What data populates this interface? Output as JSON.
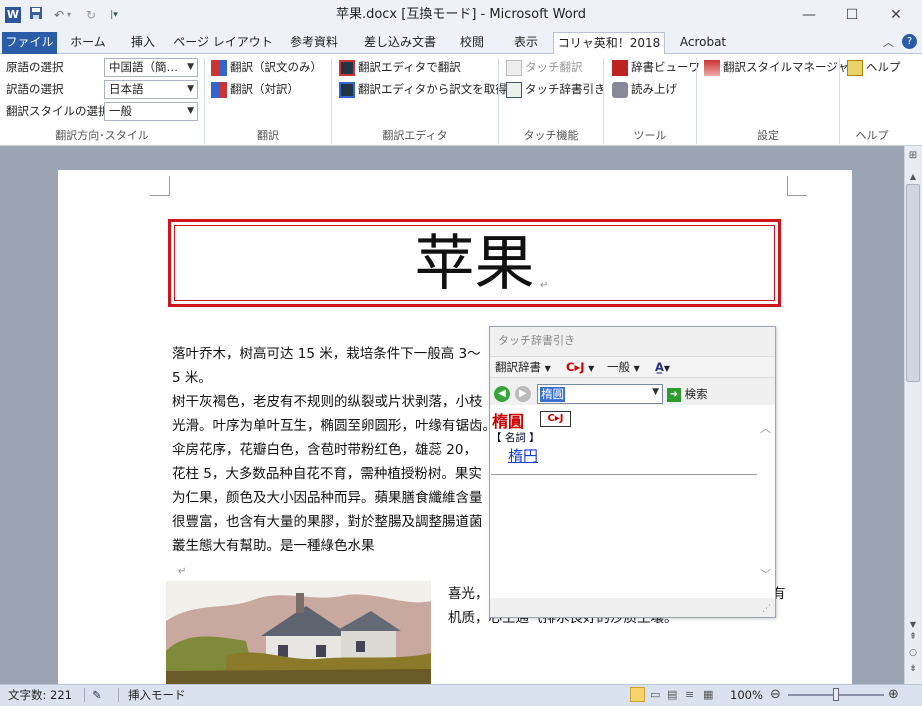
{
  "window": {
    "title": "苹果.docx [互換モード] - Microsoft Word",
    "app_icon": "word-icon",
    "qat": [
      "save-icon",
      "undo-icon",
      "redo-icon",
      "customize-icon"
    ],
    "controls": [
      "minimize-icon",
      "maximize-icon",
      "close-icon"
    ]
  },
  "tabs": {
    "file": "ファイル",
    "home": "ホーム",
    "insert": "挿入",
    "layout": "ページ レイアウト",
    "references": "参考資料",
    "mailings": "差し込み文書",
    "review": "校閲",
    "view": "表示",
    "koryak": "コリャ英和！2018",
    "acrobat": "Acrobat"
  },
  "ribbon": {
    "direction": {
      "source_label": "原語の選択",
      "source_value": "中国語（簡…",
      "target_label": "訳語の選択",
      "target_value": "日本語",
      "style_label": "翻訳スタイルの選択",
      "style_value": "一般",
      "group": "翻訳方向･スタイル"
    },
    "translate": {
      "item1": "翻訳（訳文のみ）",
      "item2": "翻訳（対訳）",
      "group": "翻訳"
    },
    "editor": {
      "item1": "翻訳エディタで翻訳",
      "item2": "翻訳エディタから訳文を取得",
      "group": "翻訳エディタ"
    },
    "touch": {
      "item1": "タッチ翻訳",
      "item2": "タッチ辞書引き",
      "group": "タッチ機能"
    },
    "tools": {
      "item1": "辞書ビューワ",
      "item2": "読み上げ",
      "group": "ツール"
    },
    "settings": {
      "item1": "翻訳スタイルマネージャ",
      "group": "設定"
    },
    "help": {
      "item1": "ヘルプ",
      "group": "ヘルプ"
    }
  },
  "document": {
    "title": "苹果",
    "lines": [
      "落叶乔木，树高可达 15 米，栽培条件下一般高 3～",
      "5 米。",
      "树干灰褐色，老皮有不规则的纵裂或片状剥落，小枝",
      "光滑。叶序为单叶互生，椭圆至卵圆形，叶缘有锯齿。",
      "伞房花序，花瓣白色，含苞时带粉红色，雄蕊 20，",
      "花柱 5，大多数品种自花不育，需种植授粉树。果实",
      "为仁果，颜色及大小因品种而异。蘋果膳食纖維含量",
      "很豐富，也含有大量的果膠，對於整腸及調整腸道菌",
      "叢生態大有幫助。是一種綠色水果"
    ],
    "side_line1": "喜光，",
    "side_line1_end": "有",
    "side_line2": "机质，心土通气排水良好的沙质土壤。"
  },
  "popup": {
    "title": "タッチ辞書引き",
    "toolbar": {
      "dict": "翻訳辞書",
      "cj": "C▸J",
      "general": "一般"
    },
    "search_value": "楕圓",
    "search_button": "検索",
    "headword": "楕圓",
    "badge": "C▸J",
    "pos": "【 名詞 】",
    "translation": "楕円"
  },
  "statusbar": {
    "word_count": "文字数: 221",
    "mode": "挿入モード",
    "zoom": "100%",
    "zoom_level": 0.5
  },
  "colors": {
    "file_tab": "#2a5ca8",
    "title_border": "#d0151f",
    "headword": "#cc0000",
    "link": "#1a3fd0"
  }
}
